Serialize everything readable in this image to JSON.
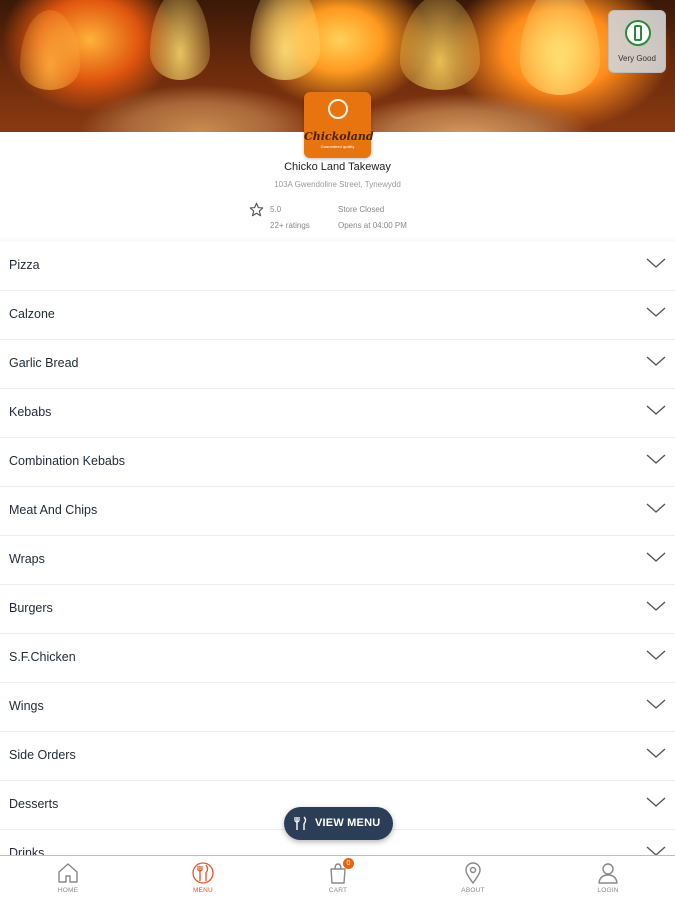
{
  "header": {
    "badge_text": "Very Good",
    "logo_text": "Chickoland",
    "logo_subtext": "Guaranteed quality"
  },
  "store": {
    "name": "Chicko Land Takeway",
    "address": "103A Gwendoline Street, Tynewydd",
    "rating": "5.0",
    "ratings_count": "22+ ratings",
    "status": "Store Closed",
    "opens_at": "Opens at 04:00 PM"
  },
  "menu": {
    "categories": [
      "Pizza",
      "Calzone",
      "Garlic Bread",
      "Kebabs",
      "Combination Kebabs",
      "Meat And Chips",
      "Wraps",
      "Burgers",
      "S.F.Chicken",
      "Wings",
      "Side Orders",
      "Desserts",
      "Drinks"
    ]
  },
  "view_menu": {
    "label": "VIEW MENU"
  },
  "nav": {
    "items": [
      {
        "label": "HOME",
        "icon": "home-icon"
      },
      {
        "label": "MENU",
        "icon": "cutlery-icon"
      },
      {
        "label": "CART",
        "icon": "cart-icon"
      },
      {
        "label": "ABOUT",
        "icon": "location-pin-icon"
      },
      {
        "label": "LOGIN",
        "icon": "user-icon"
      }
    ],
    "cart_count": "0",
    "active": "MENU"
  },
  "colors": {
    "brand_orange": "#e8740f",
    "active_nav": "#e0552e",
    "view_menu_bg": "#2c3e57",
    "text_dark": "#1f2a3a"
  }
}
